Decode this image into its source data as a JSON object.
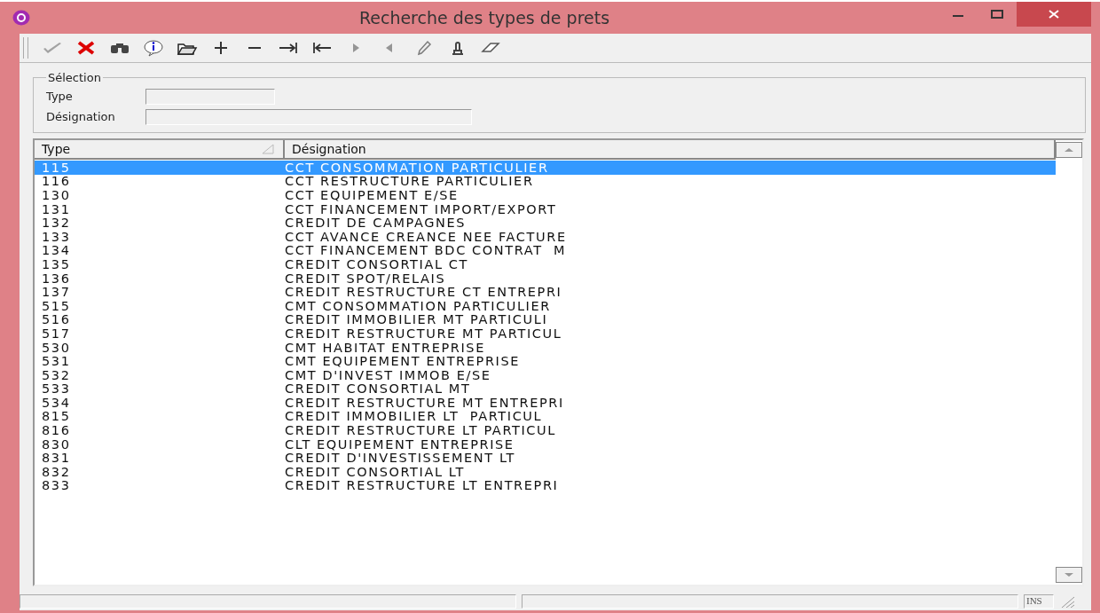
{
  "window": {
    "title": "Recherche des types de prets"
  },
  "toolbar": [
    {
      "kind": "check",
      "disabled": true
    },
    {
      "kind": "cancel",
      "disabled": false
    },
    {
      "kind": "find",
      "disabled": false
    },
    {
      "kind": "info",
      "disabled": false
    },
    {
      "kind": "open",
      "disabled": false
    },
    {
      "kind": "plus",
      "disabled": false
    },
    {
      "kind": "minus",
      "disabled": false
    },
    {
      "kind": "last",
      "disabled": false
    },
    {
      "kind": "first",
      "disabled": false
    },
    {
      "kind": "next",
      "disabled": true
    },
    {
      "kind": "prev",
      "disabled": true
    },
    {
      "kind": "edit",
      "disabled": true
    },
    {
      "kind": "stamp",
      "disabled": false
    },
    {
      "kind": "erase",
      "disabled": false
    }
  ],
  "selection": {
    "title": "Sélection",
    "fields": [
      {
        "label": "Type"
      },
      {
        "label": "Désignation"
      }
    ]
  },
  "table": {
    "columns": [
      "Type",
      "Désignation"
    ],
    "rows": [
      {
        "type": "115",
        "designation": "CCT CONSOMMATION PARTICULIER",
        "selected": true
      },
      {
        "type": "116",
        "designation": "CCT RESTRUCTURE PARTICULIER",
        "selected": false
      },
      {
        "type": "130",
        "designation": "CCT EQUIPEMENT E/SE",
        "selected": false
      },
      {
        "type": "131",
        "designation": "CCT FINANCEMENT IMPORT/EXPORT",
        "selected": false
      },
      {
        "type": "132",
        "designation": "CREDIT DE CAMPAGNES",
        "selected": false
      },
      {
        "type": "133",
        "designation": "CCT AVANCE CREANCE NEE FACTURE",
        "selected": false
      },
      {
        "type": "134",
        "designation": "CCT FINANCEMENT BDC CONTRAT  M",
        "selected": false
      },
      {
        "type": "135",
        "designation": "CREDIT CONSORTIAL CT",
        "selected": false
      },
      {
        "type": "136",
        "designation": "CREDIT SPOT/RELAIS",
        "selected": false
      },
      {
        "type": "137",
        "designation": "CREDIT RESTRUCTURE CT ENTREPRI",
        "selected": false
      },
      {
        "type": "515",
        "designation": "CMT CONSOMMATION PARTICULIER",
        "selected": false
      },
      {
        "type": "516",
        "designation": "CREDIT IMMOBILIER MT PARTICULI",
        "selected": false
      },
      {
        "type": "517",
        "designation": "CREDIT RESTRUCTURE MT PARTICUL",
        "selected": false
      },
      {
        "type": "530",
        "designation": "CMT HABITAT ENTREPRISE",
        "selected": false
      },
      {
        "type": "531",
        "designation": "CMT EQUIPEMENT ENTREPRISE",
        "selected": false
      },
      {
        "type": "532",
        "designation": "CMT D'INVEST IMMOB E/SE",
        "selected": false
      },
      {
        "type": "533",
        "designation": "CREDIT CONSORTIAL MT",
        "selected": false
      },
      {
        "type": "534",
        "designation": "CREDIT RESTRUCTURE MT ENTREPRI",
        "selected": false
      },
      {
        "type": "815",
        "designation": "CREDIT IMMOBILIER LT  PARTICUL",
        "selected": false
      },
      {
        "type": "816",
        "designation": "CREDIT RESTRUCTURE LT PARTICUL",
        "selected": false
      },
      {
        "type": "830",
        "designation": "CLT EQUIPEMENT ENTREPRISE",
        "selected": false
      },
      {
        "type": "831",
        "designation": "CREDIT D'INVESTISSEMENT LT",
        "selected": false
      },
      {
        "type": "832",
        "designation": "CREDIT CONSORTIAL LT",
        "selected": false
      },
      {
        "type": "833",
        "designation": "CREDIT RESTRUCTURE LT ENTREPRI",
        "selected": false
      }
    ]
  },
  "status_bar": {
    "mode": "INS"
  }
}
